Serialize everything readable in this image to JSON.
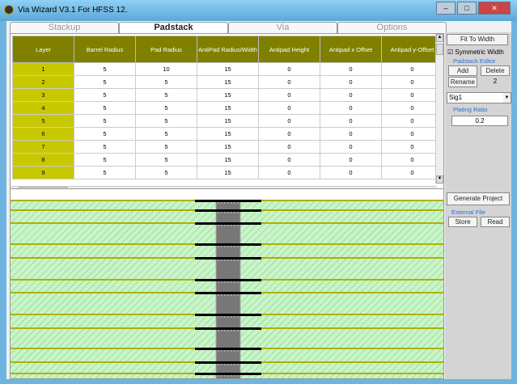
{
  "window": {
    "title": "Via Wizard V3.1 For HFSS 12.",
    "min": "–",
    "max": "□",
    "close": "✕"
  },
  "tabs": [
    "Stackup",
    "Padstack",
    "Via",
    "Options"
  ],
  "table": {
    "headers": [
      "Layer",
      "Barrel Radius",
      "Pad Radius",
      "AntiPad Radius/Width",
      "Antipad Height",
      "Antipad x Offset",
      "Antipad y-Offset"
    ],
    "rows": [
      [
        "1",
        "5",
        "10",
        "15",
        "0",
        "0",
        "0"
      ],
      [
        "2",
        "5",
        "5",
        "15",
        "0",
        "0",
        "0"
      ],
      [
        "3",
        "5",
        "5",
        "15",
        "0",
        "0",
        "0"
      ],
      [
        "4",
        "5",
        "5",
        "15",
        "0",
        "0",
        "0"
      ],
      [
        "5",
        "5",
        "5",
        "15",
        "0",
        "0",
        "0"
      ],
      [
        "6",
        "5",
        "5",
        "15",
        "0",
        "0",
        "0"
      ],
      [
        "7",
        "5",
        "5",
        "15",
        "0",
        "0",
        "0"
      ],
      [
        "8",
        "5",
        "5",
        "15",
        "0",
        "0",
        "0"
      ],
      [
        "9",
        "5",
        "5",
        "15",
        "0",
        "0",
        "0"
      ]
    ]
  },
  "side": {
    "fit_button": "Fit To Width",
    "symmetric_label": "Symmetric Width",
    "padstack_editor": "Padstack Editor",
    "add": "Add",
    "delete": "Delete",
    "rename": "Rename",
    "count": "2",
    "layer_select": "Sig1",
    "plating_ratio_label": "Plating Ratio",
    "plating_ratio": "0.2",
    "generate": "Generate Project",
    "external_file": "External File",
    "store": "Store",
    "read": "Read"
  },
  "colors": {
    "header": "#808000",
    "layer_cell": "#c8c800",
    "dielectric": "#c8f5c8",
    "copper": "#b0b000"
  }
}
